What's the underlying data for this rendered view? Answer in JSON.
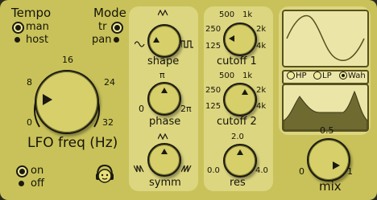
{
  "tempo": {
    "title": "Tempo",
    "options": [
      "man",
      "host"
    ],
    "selected": "man"
  },
  "mode": {
    "title": "Mode",
    "options": [
      "tr",
      "pan"
    ],
    "selected": "tr"
  },
  "lfo_freq": {
    "label": "LFO freq (Hz)",
    "ticks": [
      "0",
      "8",
      "16",
      "24",
      "32"
    ]
  },
  "power": {
    "options": [
      "on",
      "off"
    ],
    "selected": "on"
  },
  "shape": {
    "label": "shape"
  },
  "phase": {
    "label": "phase",
    "ticks": [
      "0",
      "π",
      "2π"
    ]
  },
  "symm": {
    "label": "symm"
  },
  "cutoff1": {
    "label": "cutoff 1",
    "ticks": [
      "125",
      "250",
      "500",
      "1k",
      "2k",
      "4k"
    ]
  },
  "cutoff2": {
    "label": "cutoff 2",
    "ticks": [
      "125",
      "250",
      "500",
      "1k",
      "2k",
      "4k"
    ]
  },
  "res": {
    "label": "res",
    "ticks": [
      "0.0",
      "2.0",
      "4.0"
    ]
  },
  "filter": {
    "options": [
      "HP",
      "LP",
      "Wah"
    ],
    "selected": "Wah"
  },
  "mix": {
    "label": "mix",
    "ticks": [
      "0",
      "0.5",
      "1"
    ]
  },
  "colors": {
    "background": "#c9c25a",
    "panel": "#ddd680",
    "ink": "#14140a",
    "screen": "#ece5a8"
  }
}
